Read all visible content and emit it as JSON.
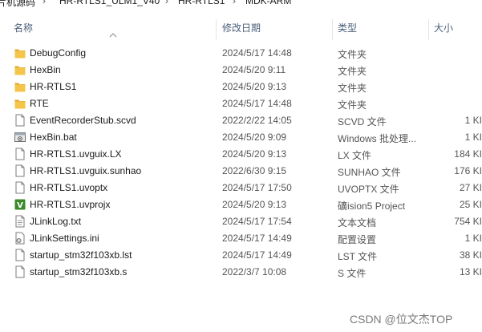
{
  "breadcrumb": [
    "片机源码",
    "HR-RTLS1_ULM1_V40",
    "HR-RTLS1",
    "MDK-ARM"
  ],
  "columns": {
    "name": "名称",
    "date": "修改日期",
    "type": "类型",
    "size": "大小"
  },
  "files": [
    {
      "icon": "folder-icon",
      "name": "DebugConfig",
      "date": "2024/5/17 14:48",
      "type": "文件夹",
      "size": ""
    },
    {
      "icon": "folder-icon",
      "name": "HexBin",
      "date": "2024/5/20 9:11",
      "type": "文件夹",
      "size": ""
    },
    {
      "icon": "folder-icon",
      "name": "HR-RTLS1",
      "date": "2024/5/20 9:13",
      "type": "文件夹",
      "size": ""
    },
    {
      "icon": "folder-icon",
      "name": "RTE",
      "date": "2024/5/17 14:48",
      "type": "文件夹",
      "size": ""
    },
    {
      "icon": "document-icon",
      "name": "EventRecorderStub.scvd",
      "date": "2022/2/22 14:05",
      "type": "SCVD 文件",
      "size": "1 KI"
    },
    {
      "icon": "batch-file-icon",
      "name": "HexBin.bat",
      "date": "2024/5/20 9:09",
      "type": "Windows 批处理...",
      "size": "1 KI"
    },
    {
      "icon": "document-icon",
      "name": "HR-RTLS1.uvguix.LX",
      "date": "2024/5/20 9:13",
      "type": "LX 文件",
      "size": "184 KI"
    },
    {
      "icon": "document-icon",
      "name": "HR-RTLS1.uvguix.sunhao",
      "date": "2022/6/30 9:15",
      "type": "SUNHAO 文件",
      "size": "176 KI"
    },
    {
      "icon": "document-icon",
      "name": "HR-RTLS1.uvoptx",
      "date": "2024/5/17 17:50",
      "type": "UVOPTX 文件",
      "size": "27 KI"
    },
    {
      "icon": "keil-project-icon",
      "name": "HR-RTLS1.uvprojx",
      "date": "2024/5/20 9:13",
      "type": "礦ision5 Project",
      "size": "25 KI"
    },
    {
      "icon": "text-file-icon",
      "name": "JLinkLog.txt",
      "date": "2024/5/17 17:54",
      "type": "文本文档",
      "size": "754 KI"
    },
    {
      "icon": "settings-file-icon",
      "name": "JLinkSettings.ini",
      "date": "2024/5/17 14:49",
      "type": "配置设置",
      "size": "1 KI"
    },
    {
      "icon": "document-icon",
      "name": "startup_stm32f103xb.lst",
      "date": "2024/5/17 14:49",
      "type": "LST 文件",
      "size": "38 KI"
    },
    {
      "icon": "document-icon",
      "name": "startup_stm32f103xb.s",
      "date": "2022/3/7 10:08",
      "type": "S 文件",
      "size": "13 KI"
    }
  ],
  "watermark": "CSDN @位文杰TOP",
  "colors": {
    "folder": "#f4c54a",
    "folder_dark": "#e0a82e",
    "header_text": "#4c607a",
    "keil_green": "#3a8a2a"
  }
}
